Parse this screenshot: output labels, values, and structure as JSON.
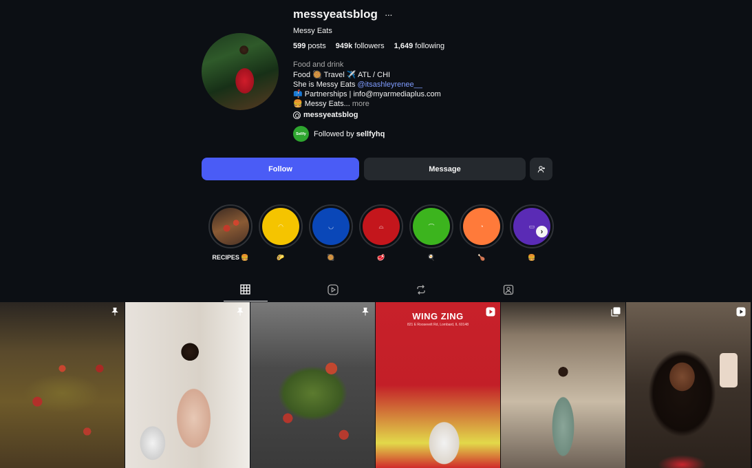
{
  "profile": {
    "username": "messyeatsblog",
    "more_label": "···",
    "full_name": "Messy Eats",
    "stats": {
      "posts_count": "599",
      "posts_label": "posts",
      "followers_count": "949k",
      "followers_label": "followers",
      "following_count": "1,649",
      "following_label": "following"
    },
    "category": "Food and drink",
    "bio": {
      "line1": "Food 🥘 Travel ✈️ ATL / CHI",
      "line2_prefix": "She is Messy Eats ",
      "line2_link": "@itsashleyrenee__",
      "line3": "📫 Partnerships | info@myarmediaplus.com",
      "line4": "🍔 Messy Eats... ",
      "line4_more": "more"
    },
    "threads_handle": "messyeatsblog",
    "followed_by_prefix": "Followed by ",
    "followed_by_user": "sellfyhq",
    "followed_by_avatar_text": "Sellfy"
  },
  "actions": {
    "follow_label": "Follow",
    "message_label": "Message"
  },
  "highlights": [
    {
      "label": "RECIPES 🍔",
      "color": "#5b3a2a",
      "icon": "food-photo"
    },
    {
      "label": "🌮",
      "color": "#f5c400",
      "icon": "taco-icon"
    },
    {
      "label": "🥘",
      "color": "#0a47b8",
      "icon": "bowl-icon"
    },
    {
      "label": "🥩",
      "color": "#c4161c",
      "icon": "steak-icon"
    },
    {
      "label": "🍳",
      "color": "#3cb41e",
      "icon": "pan-icon"
    },
    {
      "label": "🍗",
      "color": "#ff7a3a",
      "icon": "drumstick-icon"
    },
    {
      "label": "🍔",
      "color": "#5a2bb5",
      "icon": "burger-icon"
    }
  ],
  "tabs": [
    {
      "name": "posts",
      "icon": "grid-icon",
      "active": true
    },
    {
      "name": "reels",
      "icon": "reels-icon",
      "active": false
    },
    {
      "name": "reposts",
      "icon": "repost-icon",
      "active": false
    },
    {
      "name": "tagged",
      "icon": "tagged-icon",
      "active": false
    }
  ],
  "posts": [
    {
      "overlay": "pin-icon",
      "desc": "pasta skillet"
    },
    {
      "overlay": "pin-icon",
      "desc": "woman in robe"
    },
    {
      "overlay": "pin-icon",
      "desc": "sausage and green beans"
    },
    {
      "overlay": "reel-icon",
      "title": "WING ZING",
      "subtitle": "821 E Roosevelt Rd, Lombard, IL 60148"
    },
    {
      "overlay": "carousel-icon",
      "desc": "mirror selfie"
    },
    {
      "overlay": "reel-icon",
      "desc": "selfie"
    }
  ],
  "colors": {
    "background": "#0c0f14",
    "follow_button": "#4a5cf6",
    "secondary_button": "#25292e",
    "link": "#7f9cff"
  }
}
